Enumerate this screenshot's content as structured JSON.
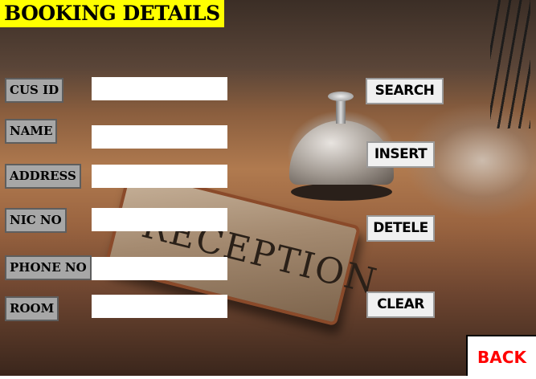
{
  "header": {
    "title": "BOOKING DETAILS"
  },
  "form": {
    "fields": [
      {
        "label": "CUS  ID",
        "value": "",
        "placeholder": ""
      },
      {
        "label": "NAME",
        "value": "",
        "placeholder": ""
      },
      {
        "label": "ADDRESS",
        "value": "",
        "placeholder": ""
      },
      {
        "label": "NIC  NO",
        "value": "",
        "placeholder": ""
      },
      {
        "label": "PHONE  NO",
        "value": "",
        "placeholder": ""
      },
      {
        "label": "ROOM",
        "value": "",
        "placeholder": ""
      }
    ]
  },
  "actions": {
    "search": "SEARCH",
    "insert": "INSERT",
    "delete": "DETELE",
    "clear": "CLEAR",
    "back": "BACK"
  },
  "background": {
    "sign_text": "RECEPTION"
  },
  "colors": {
    "title_bg": "#ffff00",
    "label_bg": "#a7a7a7",
    "back_text": "#ff0000"
  }
}
